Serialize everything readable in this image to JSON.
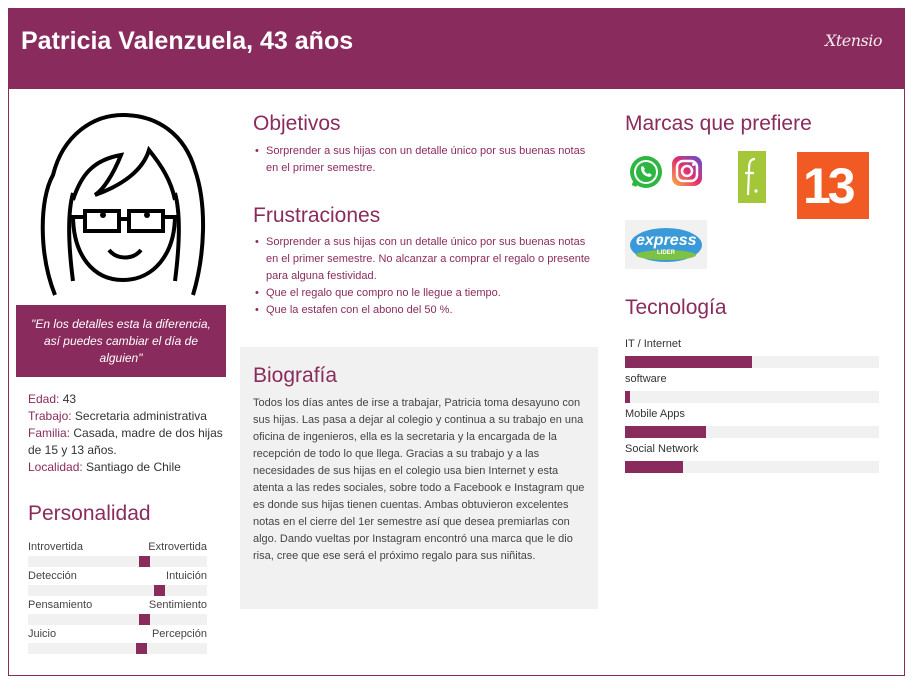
{
  "header": {
    "title": "Patricia Valenzuela, 43 años",
    "brand": "Xtensio"
  },
  "quote": "\"En los detalles esta la diferencia, así puedes cambiar el día de alguien\"",
  "facts": [
    {
      "key": "Edad:",
      "value": " 43"
    },
    {
      "key": "Trabajo:",
      "value": " Secretaria administrativa"
    },
    {
      "key": "Familia:",
      "value": " Casada, madre de dos hijas de 15 y 13 años."
    },
    {
      "key": "Localidad:",
      "value": " Santiago de Chile"
    }
  ],
  "personality": {
    "title": "Personalidad",
    "traits": [
      {
        "left": "Introvertida",
        "right": "Extrovertida",
        "level": 0.66
      },
      {
        "left": "Detección",
        "right": "Intuición",
        "level": 0.75
      },
      {
        "left": "Pensamiento",
        "right": "Sentimiento",
        "level": 0.66
      },
      {
        "left": "Juicio",
        "right": "Percepción",
        "level": 0.64
      }
    ]
  },
  "objectives": {
    "title": "Objetivos",
    "items": [
      "Sorprender a sus hijas con un detalle único por sus buenas notas en el primer semestre."
    ]
  },
  "frustrations": {
    "title": "Frustraciones",
    "items": [
      "Sorprender a sus hijas con un detalle único por sus buenas notas en el primer semestre. No alcanzar a comprar el regalo o presente para alguna festividad.",
      "Que el regalo que compro no le llegue a tiempo.",
      "Que la estafen con el abono del 50 %."
    ]
  },
  "biography": {
    "title": "Biografía",
    "text": "Todos los días antes de irse a trabajar, Patricia toma desayuno con sus hijas. Las pasa a dejar al colegio y continua a su trabajo en una oficina de ingenieros, ella es la secretaria y la encargada de la recepción de todo lo que llega. Gracias a su trabajo y a las necesidades de sus hijas en el colegio usa bien Internet y esta atenta a las redes sociales, sobre todo a Facebook e Instagram que es donde sus hijas tienen cuentas. Ambas obtuvieron excelentes notas en el cierre del 1er semestre así que desea premiarlas con algo. Dando vueltas por Instagram encontró una marca que le dio risa, cree que ese será el próximo regalo para sus niñitas."
  },
  "brands": {
    "title": "Marcas que prefiere",
    "logos": [
      "whatsapp-logo",
      "instagram-logo",
      "falabella-logo",
      "canal-13-logo",
      "express-lider-logo"
    ],
    "canal13_text": "13",
    "express_text": "express",
    "lider_text": "LIDER"
  },
  "technology": {
    "title": "Tecnología",
    "items": [
      {
        "label": "IT / Internet",
        "level": 0.5
      },
      {
        "label": "software",
        "level": 0.02
      },
      {
        "label": "Mobile Apps",
        "level": 0.32
      },
      {
        "label": "Social Network",
        "level": 0.23
      }
    ]
  },
  "colors": {
    "accent": "#8a2b5d",
    "panel": "#f1f1f1"
  }
}
